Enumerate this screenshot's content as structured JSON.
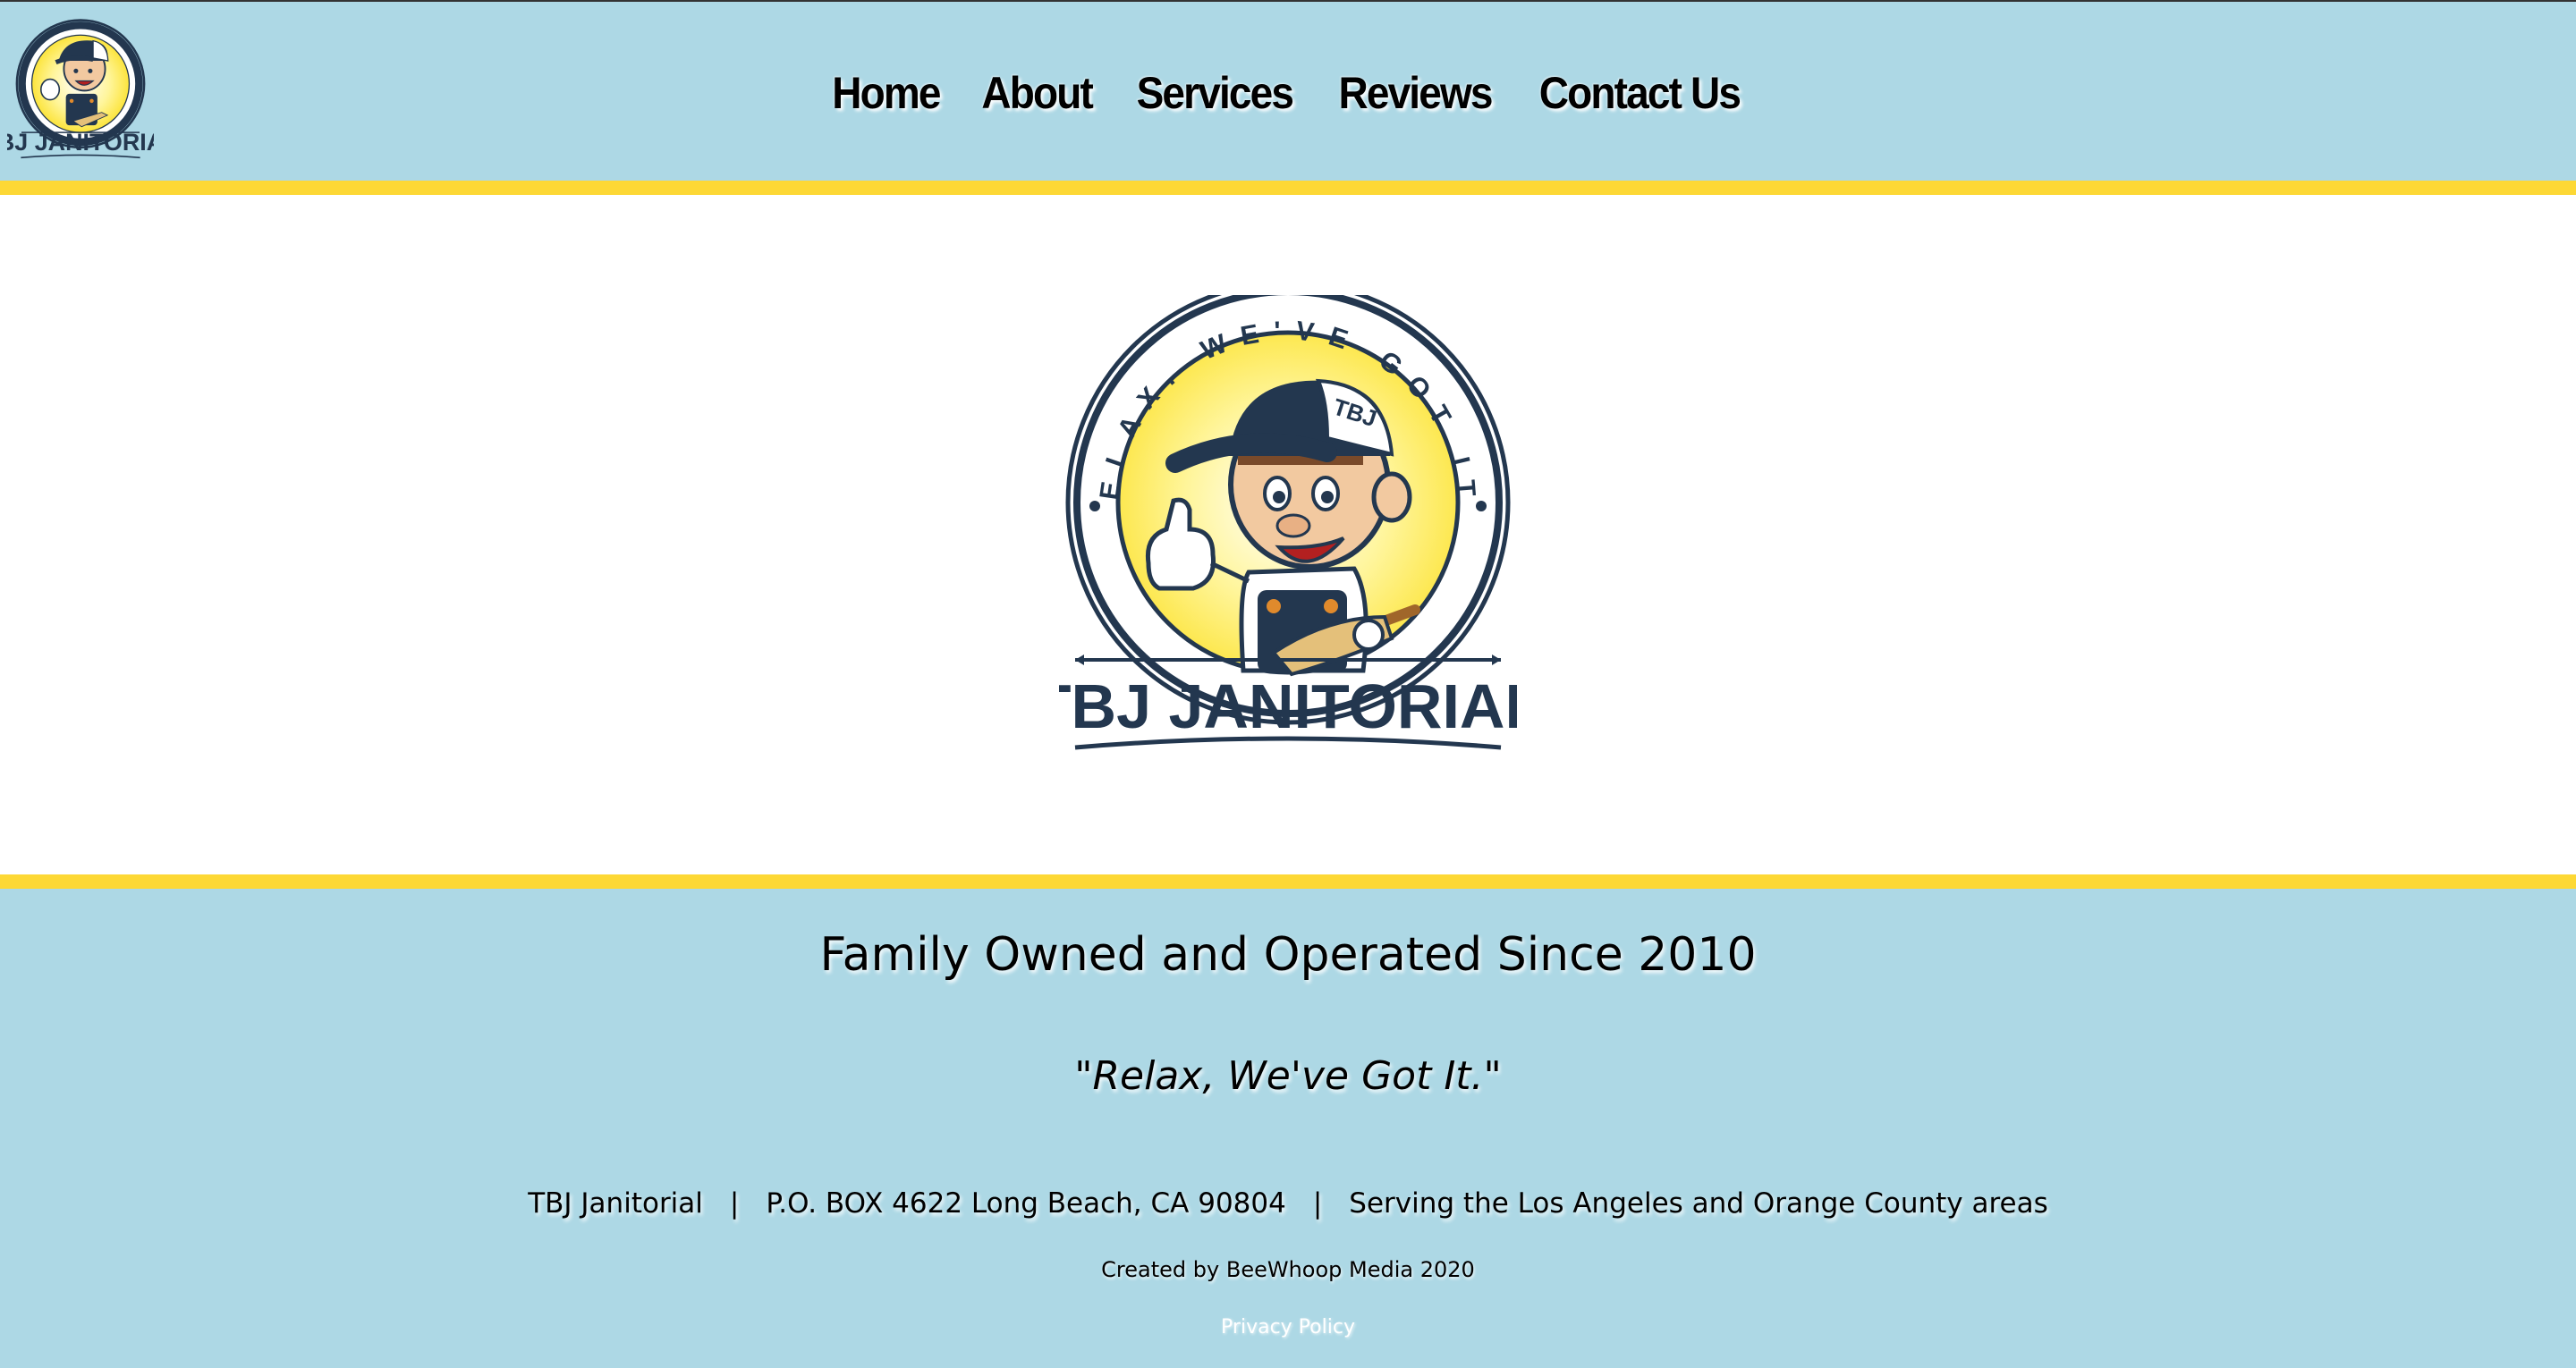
{
  "header": {
    "logo_alt": "TBJ Janitorial logo",
    "nav": [
      {
        "label": "Home"
      },
      {
        "label": "About"
      },
      {
        "label": "Services"
      },
      {
        "label": "Reviews"
      },
      {
        "label": "Contact Us"
      }
    ]
  },
  "hero": {
    "logo_ring_text": "RELAX. WE'VE GOT IT!",
    "logo_cap_text": "TBJ",
    "logo_brand_text": "TBJ JANITORIAL"
  },
  "footer": {
    "tagline": "Family Owned and Operated Since 2010",
    "motto": "\"Relax, We've Got It.\"",
    "company": "TBJ Janitorial",
    "separator": "|",
    "address": "P.O. BOX 4622 Long Beach, CA 90804",
    "service_area": "Serving the Los Angeles and Orange County areas",
    "credit": "Created by BeeWhoop Media 2020",
    "privacy_label": "Privacy Policy"
  },
  "colors": {
    "header_bg": "#add8e5",
    "stripe": "#fdd835",
    "brand_navy": "#23374f",
    "badge_yellow": "#fce43c"
  }
}
